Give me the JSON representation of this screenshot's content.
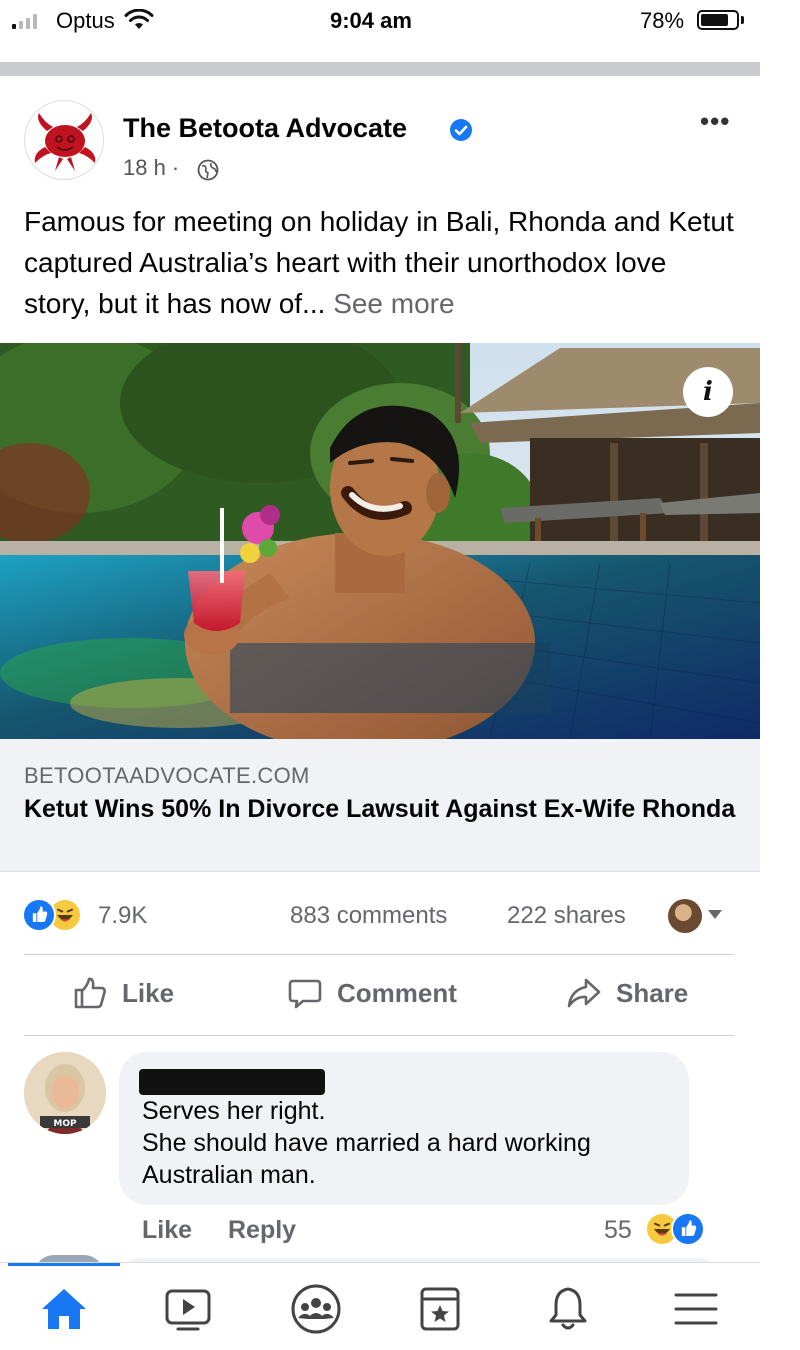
{
  "status_bar": {
    "carrier": "Optus",
    "time": "9:04 am",
    "battery_percent": "78%",
    "battery_level": 0.78,
    "signal_bars_filled": 1
  },
  "post": {
    "page_name": "The Betoota Advocate",
    "verified": true,
    "time_ago": "18 h ·",
    "text": "Famous for meeting on holiday in Bali, Rhonda and Ketut captured Australia’s heart with their unorthodox love story, but it has now of...",
    "see_more": "See more",
    "link": {
      "domain": "BETOOTAADVOCATE.COM",
      "title": "Ketut Wins 50% In Divorce Lawsuit Against Ex-Wife Rhonda"
    },
    "stats": {
      "reaction_count": "7.9K",
      "comments": "883 comments",
      "shares": "222 shares"
    },
    "actions": {
      "like": "Like",
      "comment": "Comment",
      "share": "Share"
    }
  },
  "comment": {
    "text_line1": "Serves her right.",
    "text_line2": "She should have married a hard working",
    "text_line3": "Australian man.",
    "like_label": "Like",
    "reply_label": "Reply",
    "reaction_count": "55",
    "avatar_badge": "MOP"
  },
  "bottom_nav": {
    "items": [
      "home-icon",
      "watch-icon",
      "groups-icon",
      "pages-icon",
      "notifications-icon",
      "menu-icon"
    ],
    "active": "home-icon"
  },
  "colors": {
    "brand_blue": "#1877f2",
    "secondary_text": "#65676b",
    "bubble_bg": "#f0f2f5"
  }
}
